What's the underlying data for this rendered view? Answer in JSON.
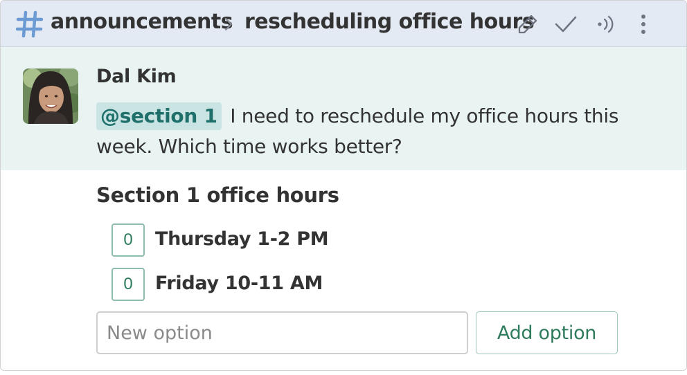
{
  "header": {
    "stream_icon": "hashtag-icon",
    "stream": "announcements",
    "separator_icon": "chevron-right-icon",
    "topic": "rescheduling office hours",
    "actions": [
      {
        "icon": "pencil-icon",
        "label": "Edit topic"
      },
      {
        "icon": "check-icon",
        "label": "Mark as resolved"
      },
      {
        "icon": "broadcast-icon",
        "label": "Follow topic"
      },
      {
        "icon": "more-vertical-icon",
        "label": "More actions"
      }
    ]
  },
  "message": {
    "sender": "Dal Kim",
    "avatar_icon": "user-avatar",
    "mention": "@section 1",
    "text": "I need to reschedule my office hours this week. Which time works better?"
  },
  "poll": {
    "title": "Section 1 office hours",
    "options": [
      {
        "votes": "0",
        "label": "Thursday 1-2 PM"
      },
      {
        "votes": "0",
        "label": "Friday 10-11 AM"
      }
    ],
    "new_option_placeholder": "New option",
    "add_option_label": "Add option"
  },
  "colors": {
    "header_bg": "#e4eaf3",
    "message_bg": "#e8f3f2",
    "mention_bg": "#c9e4e3",
    "accent_green": "#2e7c5c",
    "stream_icon": "#6b9bd2"
  }
}
